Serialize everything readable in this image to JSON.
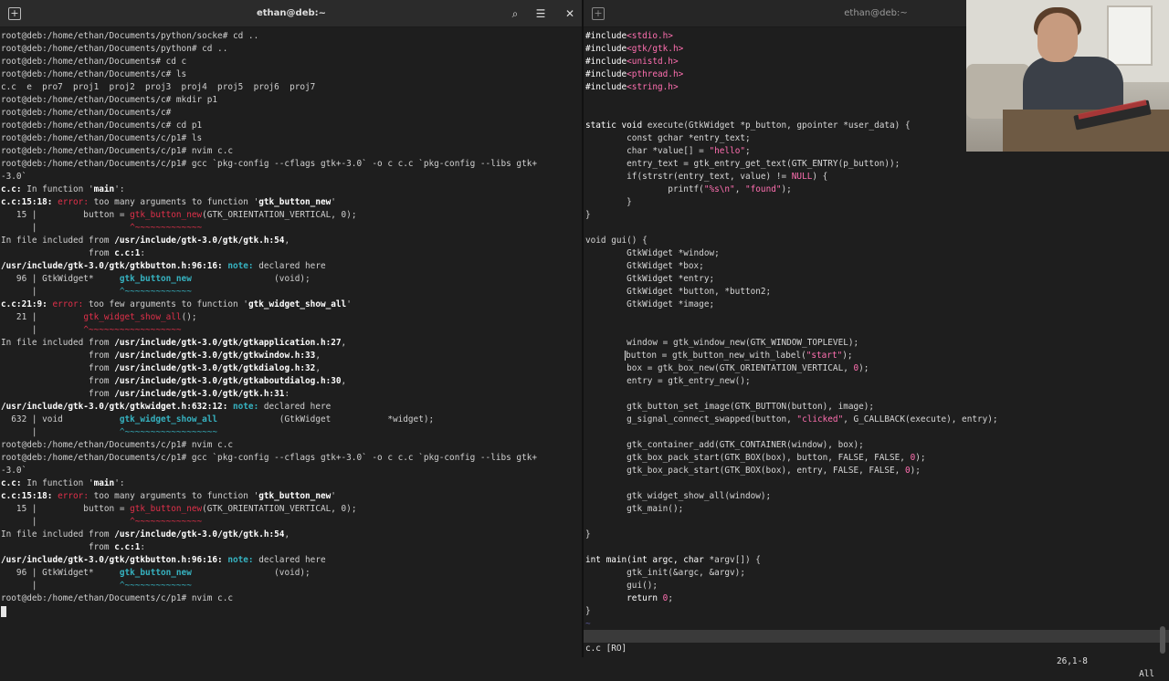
{
  "left_window": {
    "title": "ethan@deb:~",
    "buttons": {
      "new_tab": "+",
      "search": "⌕",
      "menu": "☰",
      "close": "✕"
    }
  },
  "right_window": {
    "title": "ethan@deb:~",
    "buttons": {
      "new_tab": "+"
    }
  },
  "terminal_lines": [
    [
      [
        "root@deb:/home/ethan/Documents/python/socke# cd ..",
        ""
      ]
    ],
    [
      [
        "root@deb:/home/ethan/Documents/python# cd ..",
        ""
      ]
    ],
    [
      [
        "root@deb:/home/ethan/Documents# cd c",
        ""
      ]
    ],
    [
      [
        "root@deb:/home/ethan/Documents/c# ls",
        ""
      ]
    ],
    [
      [
        "c.c  e  pro7  proj1  proj2  proj3  proj4  proj5  proj6  proj7",
        ""
      ]
    ],
    [
      [
        "root@deb:/home/ethan/Documents/c# mkdir p1",
        ""
      ]
    ],
    [
      [
        "root@deb:/home/ethan/Documents/c# ",
        ""
      ]
    ],
    [
      [
        "root@deb:/home/ethan/Documents/c# cd p1",
        ""
      ]
    ],
    [
      [
        "root@deb:/home/ethan/Documents/c/p1# ls",
        ""
      ]
    ],
    [
      [
        "root@deb:/home/ethan/Documents/c/p1# nvim c.c",
        ""
      ]
    ],
    [
      [
        "root@deb:/home/ethan/Documents/c/p1# gcc `pkg-config --cflags gtk+-3.0` -o c c.c `pkg-config --libs gtk+",
        ""
      ]
    ],
    [
      [
        "-3.0`",
        ""
      ]
    ],
    [
      [
        "c.c:",
        "b"
      ],
      [
        " In function '",
        ""
      ],
      [
        "main",
        "b"
      ],
      [
        "':",
        ""
      ]
    ],
    [
      [
        "c.c:15:18: ",
        "b"
      ],
      [
        "error: ",
        "e"
      ],
      [
        "too many arguments to function '",
        ""
      ],
      [
        "gtk_button_new",
        "b"
      ],
      [
        "'",
        ""
      ]
    ],
    [
      [
        "   15 |         button = ",
        ""
      ],
      [
        "gtk_button_new",
        "h"
      ],
      [
        "(GTK_ORIENTATION_VERTICAL, 0);",
        ""
      ]
    ],
    [
      [
        "      |                  ",
        ""
      ],
      [
        "^~~~~~~~~~~~~~",
        "h"
      ]
    ],
    [
      [
        "In file included from ",
        ""
      ],
      [
        "/usr/include/gtk-3.0/gtk/gtk.h:54",
        "b"
      ],
      [
        ",",
        ""
      ]
    ],
    [
      [
        "                 from ",
        ""
      ],
      [
        "c.c:1",
        "b"
      ],
      [
        ":",
        ""
      ]
    ],
    [
      [
        "/usr/include/gtk-3.0/gtk/gtkbutton.h:96:16: ",
        "b"
      ],
      [
        "note: ",
        "n"
      ],
      [
        "declared here",
        ""
      ]
    ],
    [
      [
        "   96 | GtkWidget*     ",
        ""
      ],
      [
        "gtk_button_new",
        "bn"
      ],
      [
        "                (void);",
        ""
      ]
    ],
    [
      [
        "      |                ",
        ""
      ],
      [
        "^~~~~~~~~~~~~~",
        "c"
      ]
    ],
    [
      [
        "c.c:21:9: ",
        "b"
      ],
      [
        "error: ",
        "e"
      ],
      [
        "too few arguments to function '",
        ""
      ],
      [
        "gtk_widget_show_all",
        "b"
      ],
      [
        "'",
        ""
      ]
    ],
    [
      [
        "   21 |         ",
        ""
      ],
      [
        "gtk_widget_show_all",
        "h"
      ],
      [
        "();",
        ""
      ]
    ],
    [
      [
        "      |         ",
        ""
      ],
      [
        "^~~~~~~~~~~~~~~~~~~",
        "h"
      ]
    ],
    [
      [
        "In file included from ",
        ""
      ],
      [
        "/usr/include/gtk-3.0/gtk/gtkapplication.h:27",
        "b"
      ],
      [
        ",",
        ""
      ]
    ],
    [
      [
        "                 from ",
        ""
      ],
      [
        "/usr/include/gtk-3.0/gtk/gtkwindow.h:33",
        "b"
      ],
      [
        ",",
        ""
      ]
    ],
    [
      [
        "                 from ",
        ""
      ],
      [
        "/usr/include/gtk-3.0/gtk/gtkdialog.h:32",
        "b"
      ],
      [
        ",",
        ""
      ]
    ],
    [
      [
        "                 from ",
        ""
      ],
      [
        "/usr/include/gtk-3.0/gtk/gtkaboutdialog.h:30",
        "b"
      ],
      [
        ",",
        ""
      ]
    ],
    [
      [
        "                 from ",
        ""
      ],
      [
        "/usr/include/gtk-3.0/gtk/gtk.h:31",
        "b"
      ],
      [
        ":",
        ""
      ]
    ],
    [
      [
        "/usr/include/gtk-3.0/gtk/gtkwidget.h:632:12: ",
        "b"
      ],
      [
        "note: ",
        "n"
      ],
      [
        "declared here",
        ""
      ]
    ],
    [
      [
        "  632 | void           ",
        ""
      ],
      [
        "gtk_widget_show_all",
        "bn"
      ],
      [
        "            (GtkWidget           *widget);",
        ""
      ]
    ],
    [
      [
        "      |                ",
        ""
      ],
      [
        "^~~~~~~~~~~~~~~~~~~",
        "c"
      ]
    ],
    [
      [
        "root@deb:/home/ethan/Documents/c/p1# nvim c.c",
        ""
      ]
    ],
    [
      [
        "root@deb:/home/ethan/Documents/c/p1# gcc `pkg-config --cflags gtk+-3.0` -o c c.c `pkg-config --libs gtk+",
        ""
      ]
    ],
    [
      [
        "-3.0`",
        ""
      ]
    ],
    [
      [
        "c.c:",
        "b"
      ],
      [
        " In function '",
        ""
      ],
      [
        "main",
        "b"
      ],
      [
        "':",
        ""
      ]
    ],
    [
      [
        "c.c:15:18: ",
        "b"
      ],
      [
        "error: ",
        "e"
      ],
      [
        "too many arguments to function '",
        ""
      ],
      [
        "gtk_button_new",
        "b"
      ],
      [
        "'",
        ""
      ]
    ],
    [
      [
        "   15 |         button = ",
        ""
      ],
      [
        "gtk_button_new",
        "h"
      ],
      [
        "(GTK_ORIENTATION_VERTICAL, 0);",
        ""
      ]
    ],
    [
      [
        "      |                  ",
        ""
      ],
      [
        "^~~~~~~~~~~~~~",
        "h"
      ]
    ],
    [
      [
        "In file included from ",
        ""
      ],
      [
        "/usr/include/gtk-3.0/gtk/gtk.h:54",
        "b"
      ],
      [
        ",",
        ""
      ]
    ],
    [
      [
        "                 from ",
        ""
      ],
      [
        "c.c:1",
        "b"
      ],
      [
        ":",
        ""
      ]
    ],
    [
      [
        "/usr/include/gtk-3.0/gtk/gtkbutton.h:96:16: ",
        "b"
      ],
      [
        "note: ",
        "n"
      ],
      [
        "declared here",
        ""
      ]
    ],
    [
      [
        "   96 | GtkWidget*     ",
        ""
      ],
      [
        "gtk_button_new",
        "bn"
      ],
      [
        "                (void);",
        ""
      ]
    ],
    [
      [
        "      |                ",
        ""
      ],
      [
        "^~~~~~~~~~~~~~",
        "c"
      ]
    ],
    [
      [
        "root@deb:/home/ethan/Documents/c/p1# nvim c.c",
        ""
      ]
    ]
  ],
  "code_lines": [
    [
      [
        "#include",
        "pp"
      ],
      [
        "<stdio.h>",
        "inc"
      ]
    ],
    [
      [
        "#include",
        "pp"
      ],
      [
        "<gtk/gtk.h>",
        "inc"
      ]
    ],
    [
      [
        "#include",
        "pp"
      ],
      [
        "<unistd.h>",
        "inc"
      ]
    ],
    [
      [
        "#include",
        "pp"
      ],
      [
        "<pthread.h>",
        "inc"
      ]
    ],
    [
      [
        "#include",
        "pp"
      ],
      [
        "<string.h>",
        "inc"
      ]
    ],
    [
      [
        "",
        ""
      ]
    ],
    [
      [
        "",
        ""
      ]
    ],
    [
      [
        "static void ",
        "kw"
      ],
      [
        "execute(GtkWidget *p_button, gpointer *user_data) {",
        ""
      ]
    ],
    [
      [
        "        const gchar *entry_text;",
        ""
      ]
    ],
    [
      [
        "        char *value[] = ",
        ""
      ],
      [
        "\"hello\"",
        "str"
      ],
      [
        ";",
        ""
      ]
    ],
    [
      [
        "        entry_text = gtk_entry_get_text(GTK_ENTRY(p_button));",
        ""
      ]
    ],
    [
      [
        "        if(strstr(entry_text, value) != ",
        ""
      ],
      [
        "NULL",
        "nul"
      ],
      [
        ") {",
        ""
      ]
    ],
    [
      [
        "                printf(",
        ""
      ],
      [
        "\"%s\\n\"",
        "str"
      ],
      [
        ", ",
        ""
      ],
      [
        "\"found\"",
        "str"
      ],
      [
        ");",
        ""
      ]
    ],
    [
      [
        "        }",
        ""
      ]
    ],
    [
      [
        "}",
        ""
      ]
    ],
    [
      [
        "",
        ""
      ]
    ],
    [
      [
        "void gui() {",
        ""
      ]
    ],
    [
      [
        "        GtkWidget *window;",
        ""
      ]
    ],
    [
      [
        "        GtkWidget *box;",
        ""
      ]
    ],
    [
      [
        "        GtkWidget *entry;",
        ""
      ]
    ],
    [
      [
        "        GtkWidget *button, *button2;",
        ""
      ]
    ],
    [
      [
        "        GtkWidget *image;",
        ""
      ]
    ],
    [
      [
        "",
        ""
      ]
    ],
    [
      [
        "",
        ""
      ]
    ],
    [
      [
        "        window = gtk_window_new(GTK_WINDOW_TOPLEVEL);",
        ""
      ]
    ],
    [
      [
        "        ",
        ""
      ],
      [
        "button",
        "vcursor"
      ],
      [
        " = gtk_button_new_with_label(",
        ""
      ],
      [
        "\"start\"",
        "str"
      ],
      [
        ");",
        ""
      ]
    ],
    [
      [
        "        box = gtk_box_new(GTK_ORIENTATION_VERTICAL, ",
        ""
      ],
      [
        "0",
        "num"
      ],
      [
        ");",
        ""
      ]
    ],
    [
      [
        "        entry = gtk_entry_new();",
        ""
      ]
    ],
    [
      [
        "",
        ""
      ]
    ],
    [
      [
        "        gtk_button_set_image(GTK_BUTTON(button), image);",
        ""
      ]
    ],
    [
      [
        "        g_signal_connect_swapped(button, ",
        ""
      ],
      [
        "\"clicked\"",
        "str"
      ],
      [
        ", G_CALLBACK(execute), entry);",
        ""
      ]
    ],
    [
      [
        "",
        ""
      ]
    ],
    [
      [
        "        gtk_container_add(GTK_CONTAINER(window), box);",
        ""
      ]
    ],
    [
      [
        "        gtk_box_pack_start(GTK_BOX(box), button, FALSE, FALSE, ",
        ""
      ],
      [
        "0",
        "num"
      ],
      [
        ");",
        ""
      ]
    ],
    [
      [
        "        gtk_box_pack_start(GTK_BOX(box), entry, FALSE, FALSE, ",
        ""
      ],
      [
        "0",
        "num"
      ],
      [
        ");",
        ""
      ]
    ],
    [
      [
        "",
        ""
      ]
    ],
    [
      [
        "        gtk_widget_show_all(window);",
        ""
      ]
    ],
    [
      [
        "        gtk_main();",
        ""
      ]
    ],
    [
      [
        "",
        ""
      ]
    ],
    [
      [
        "}",
        ""
      ]
    ],
    [
      [
        "",
        ""
      ]
    ],
    [
      [
        "int main(int argc, ",
        "kw"
      ],
      [
        "char ",
        "kw"
      ],
      [
        "*argv[]) {",
        ""
      ]
    ],
    [
      [
        "        gtk_init(&argc, &argv);",
        ""
      ]
    ],
    [
      [
        "        gui();",
        ""
      ]
    ],
    [
      [
        "        ",
        ""
      ],
      [
        "return ",
        "kw"
      ],
      [
        "0",
        "num"
      ],
      [
        ";",
        ""
      ]
    ],
    [
      [
        "}",
        ""
      ]
    ],
    [
      [
        "~",
        "tilde"
      ]
    ]
  ],
  "statusbar": {
    "file": "c.c [RO]",
    "position": "26,1-8",
    "scroll": "All"
  }
}
